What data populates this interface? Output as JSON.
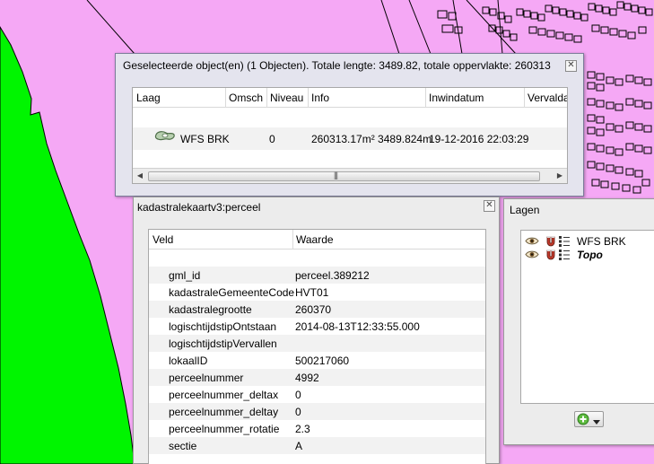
{
  "map": {
    "colors": {
      "parcel": "#f5a8f5",
      "water": "#00f500",
      "outline": "#000000"
    }
  },
  "selection_dialog": {
    "title": "Geselecteerde object(en) (1 Objecten). Totale lengte: 3489.82, totale oppervlakte: 260313",
    "columns": [
      "Laag",
      "Omsch",
      "Niveau",
      "Info",
      "Inwindatum",
      "Vervalda"
    ],
    "row": {
      "layer": "WFS BRK",
      "omsch": "",
      "niveau": "0",
      "info": "260313.17m² 3489.824m",
      "inwindatum": "19-12-2016 22:03:29",
      "icon": "polygon-layer-icon"
    },
    "scrollbar_grip": "|||"
  },
  "perceel_panel": {
    "title": "kadastralekaartv3:perceel",
    "columns": {
      "field": "Veld",
      "value": "Waarde"
    },
    "rows": [
      {
        "field": "gml_id",
        "value": "perceel.389212"
      },
      {
        "field": "kadastraleGemeenteCode",
        "value": "HVT01"
      },
      {
        "field": "kadastralegrootte",
        "value": "260370"
      },
      {
        "field": "logischtijdstipOntstaan",
        "value": "2014-08-13T12:33:55.000"
      },
      {
        "field": "logischtijdstipVervallen",
        "value": ""
      },
      {
        "field": "lokaalID",
        "value": "500217060"
      },
      {
        "field": "perceelnummer",
        "value": "4992"
      },
      {
        "field": "perceelnummer_deltax",
        "value": "0"
      },
      {
        "field": "perceelnummer_deltay",
        "value": "0"
      },
      {
        "field": "perceelnummer_rotatie",
        "value": "2.3"
      },
      {
        "field": "sectie",
        "value": "A"
      }
    ]
  },
  "lagen_panel": {
    "title": "Lagen",
    "layers": [
      {
        "label": "WFS BRK",
        "bold": false
      },
      {
        "label": "Topo",
        "bold": true
      }
    ],
    "add_button": "add-layer-button"
  }
}
